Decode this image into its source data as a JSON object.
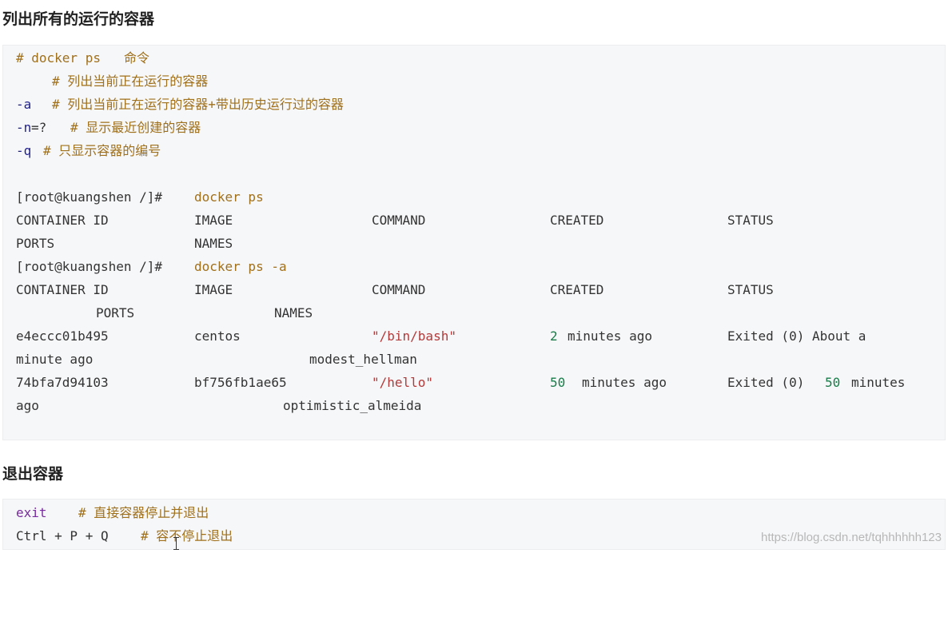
{
  "section1": {
    "title": "列出所有的运行的容器"
  },
  "section2": {
    "title": "退出容器"
  },
  "code1": {
    "l1_hash": "# docker ps",
    "l1_label": "命令",
    "l2": "# 列出当前正在运行的容器",
    "l3_flag": "-a",
    "l3_comment": "# 列出当前正在运行的容器+带出历史运行过的容器",
    "l4_flag": "-n",
    "l4_eq": "=?",
    "l4_comment": "# 显示最近创建的容器",
    "l5_flag": "-q",
    "l5_comment": "# 只显示容器的编号",
    "prompt1": "[root@kuangshen /]#",
    "cmd1": "docker ps",
    "hdr_container_id": "CONTAINER ID",
    "hdr_image": "IMAGE",
    "hdr_command": "COMMAND",
    "hdr_created": "CREATED",
    "hdr_status": "STATUS",
    "hdr_ports": "PORTS",
    "hdr_names": "NAMES",
    "prompt2": "[root@kuangshen /]#",
    "cmd2": "docker ps -a",
    "rows": [
      {
        "id": "e4eccc01b495",
        "image": "centos",
        "command": "\"/bin/bash\"",
        "created_num": "2",
        "created_rest": "minutes ago",
        "status": "Exited (0) About a",
        "status_wrap": "minute ago",
        "name": "modest_hellman"
      },
      {
        "id": "74bfa7d94103",
        "image": "bf756fb1ae65",
        "command": "\"/hello\"",
        "created_num": "50",
        "created_rest": "minutes ago",
        "status_pre": "Exited (0)",
        "status_num": "50",
        "status_post": "minutes",
        "status_wrap": "ago",
        "name": "optimistic_almeida"
      }
    ]
  },
  "code2": {
    "exit_kw": "exit",
    "exit_comment": "# 直接容器停止并退出",
    "ctrl_keys": "Ctrl + P + Q",
    "ctrl_comment": "# 容不停止退出"
  },
  "watermark": "https://blog.csdn.net/tqhhhhhh123",
  "colors": {
    "comment": "#a0701b",
    "flag": "#1f1f8a",
    "string": "#b33a3a",
    "number": "#1b7c4a",
    "keyword": "#7a2aa0",
    "code_bg": "#f6f7f9"
  }
}
